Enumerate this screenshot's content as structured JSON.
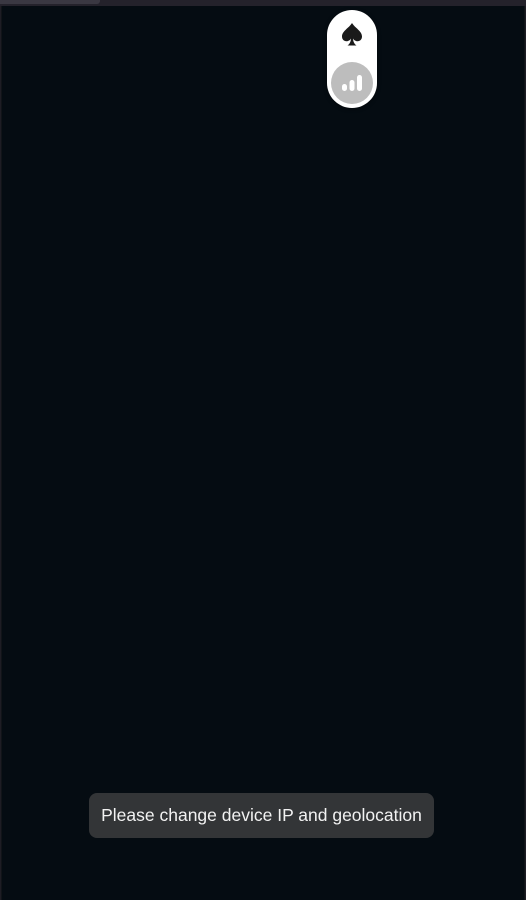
{
  "floating_menu": {
    "buttons": [
      {
        "icon": "spade-icon"
      },
      {
        "icon": "signal-bars-icon"
      }
    ]
  },
  "toast": {
    "message": "Please change device IP and geolocation"
  },
  "colors": {
    "background": "#050c12",
    "toast_background": "#333537",
    "pill_background": "#ffffff",
    "stats_button": "#bdbdbd"
  }
}
